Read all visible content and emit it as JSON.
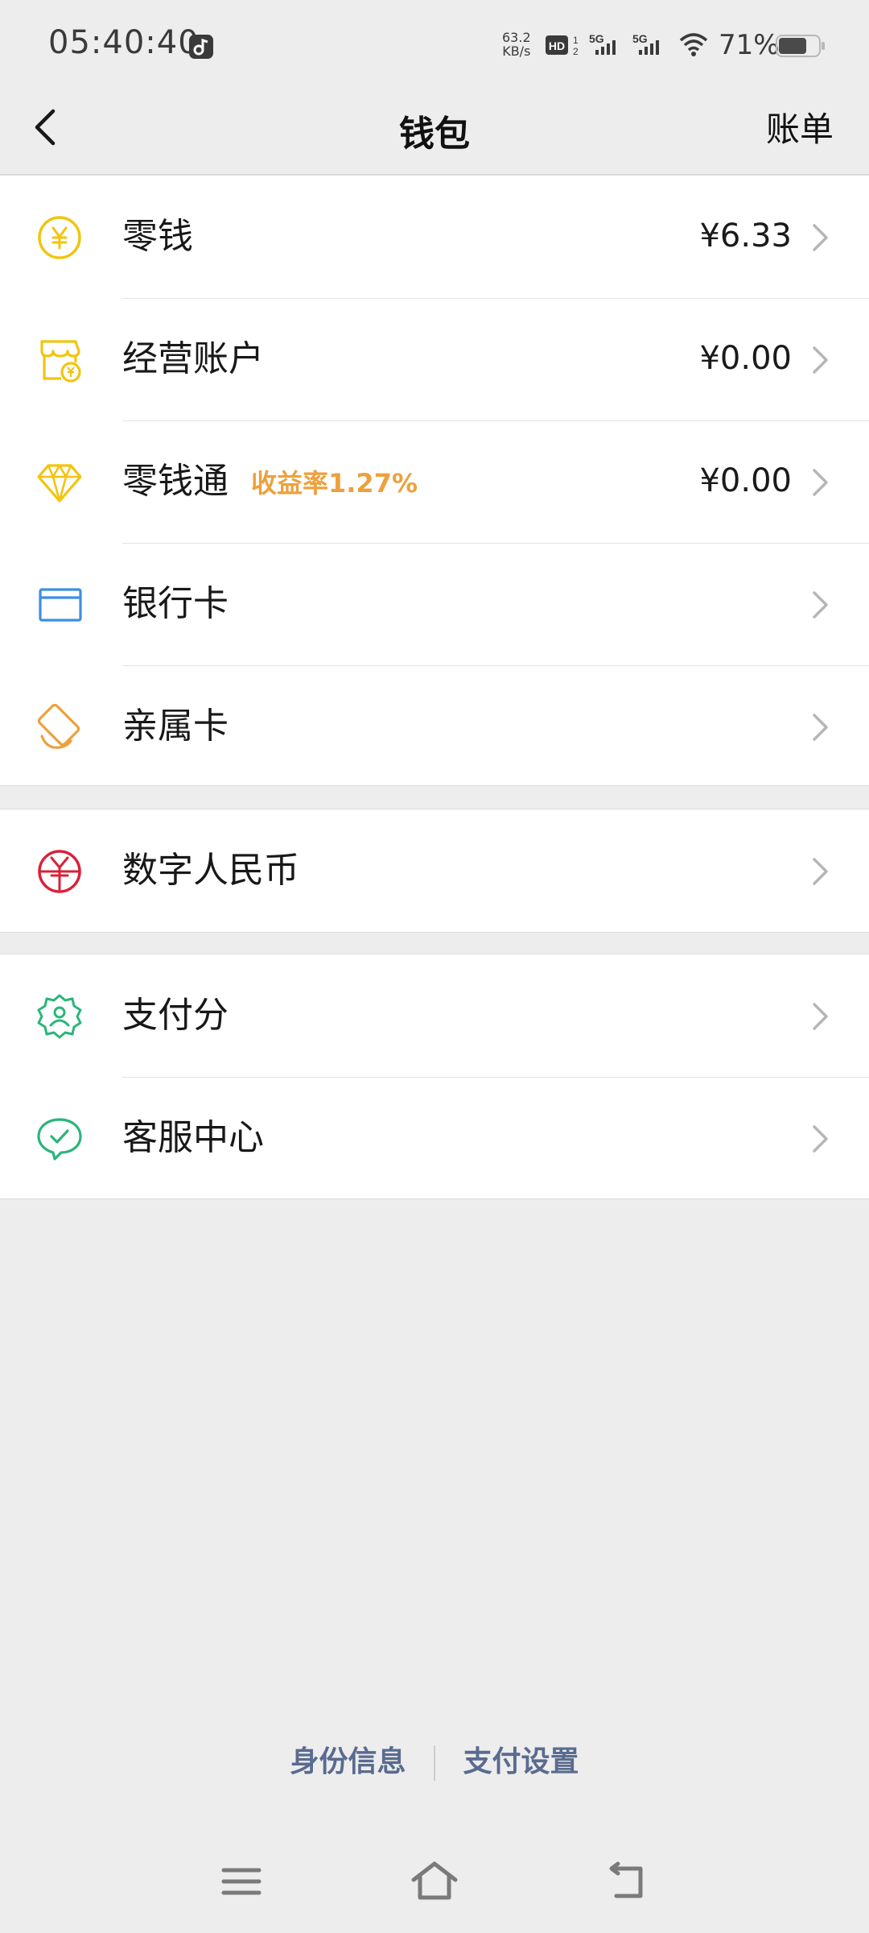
{
  "status_bar": {
    "time": "05:40:40",
    "net_speed_value": "63.2",
    "net_speed_unit": "KB/s",
    "hd_label": "HD",
    "sim1_label": "5G",
    "sim2_label": "5G",
    "battery_percent": "71%",
    "battery_level": 0.71
  },
  "header": {
    "title": "钱包",
    "bill_label": "账单",
    "back_icon": "chevron-left-icon"
  },
  "sections": [
    {
      "rows": [
        {
          "label": "零钱",
          "value": "¥6.33",
          "icon": "yuan-coin-icon",
          "icon_color": "#f2c40f"
        },
        {
          "label": "经营账户",
          "value": "¥0.00",
          "icon": "store-account-icon",
          "icon_color": "#f2c40f"
        },
        {
          "label": "零钱通",
          "badge": "收益率1.27%",
          "value": "¥0.00",
          "icon": "diamond-icon",
          "icon_color": "#f2c40f"
        },
        {
          "label": "银行卡",
          "icon": "bank-card-icon",
          "icon_color": "#3d8fe0"
        },
        {
          "label": "亲属卡",
          "icon": "family-card-icon",
          "icon_color": "#eca13d"
        }
      ]
    },
    {
      "rows": [
        {
          "label": "数字人民币",
          "icon": "digital-rmb-icon",
          "icon_color": "#d9213a"
        }
      ]
    },
    {
      "rows": [
        {
          "label": "支付分",
          "icon": "pay-score-icon",
          "icon_color": "#2bb57a"
        },
        {
          "label": "客服中心",
          "icon": "customer-service-icon",
          "icon_color": "#2bb57a"
        }
      ]
    }
  ],
  "footer": {
    "identity_label": "身份信息",
    "payment_settings_label": "支付设置",
    "link_color": "#5a6b8f"
  },
  "nav_bar": {
    "menu_icon": "menu-icon",
    "home_icon": "home-icon",
    "back_icon": "back-icon"
  }
}
